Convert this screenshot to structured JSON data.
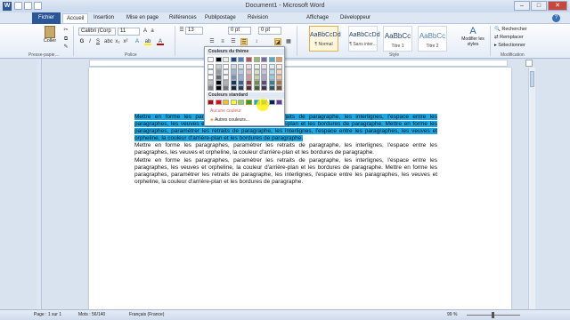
{
  "window": {
    "title": "Document1 - Microsoft Word"
  },
  "tabs": [
    "Fichier",
    "Accueil",
    "Insertion",
    "Mise en page",
    "Références",
    "Publipostage",
    "Révision",
    "Affichage",
    "Développeur"
  ],
  "ribbon": {
    "groups": {
      "clipboard": "Presse-papie…",
      "font": "Police",
      "paragraph": "",
      "styles": "Style",
      "edit": "Modification"
    },
    "paste_label": "Coller",
    "font_name": "Calibri (Corp",
    "font_size": "11",
    "spacing_value": "13",
    "before_value": "0 pt",
    "after_value": "0 pt",
    "styles": [
      {
        "sample": "AaBbCcDd",
        "label": "¶ Normal"
      },
      {
        "sample": "AaBbCcDd",
        "label": "¶ Sans inter..."
      },
      {
        "sample": "AaBbCc",
        "label": "Titre 1"
      },
      {
        "sample": "AaBbCc",
        "label": "Titre 2"
      }
    ],
    "change_styles": "Modifier les styles",
    "search": "Rechercher",
    "replace": "Remplacer",
    "select": "Sélectionner"
  },
  "palette": {
    "theme_header": "Couleurs du thème",
    "standard_header": "Couleurs standard",
    "none_label": "Aucune couleur",
    "more_label": "Autres couleurs...",
    "theme_top": [
      "#ffffff",
      "#000000",
      "#eeece1",
      "#1f497d",
      "#4f81bd",
      "#c0504d",
      "#9bbb59",
      "#8064a2",
      "#4bacc6",
      "#f79646"
    ],
    "standard": [
      "#c00000",
      "#ff0000",
      "#ffc000",
      "#ffff00",
      "#92d050",
      "#00b050",
      "#00b0f0",
      "#0070c0",
      "#002060",
      "#7030a0"
    ]
  },
  "document": {
    "p1_hl": "Mettre en forme les paragraphes, paramétrer les retraits de paragraphe, les interlignes, l'espace entre les paragraphes, les veuves et orpheline, la couleur d'arrière-plan et les bordures de paragraphe. Mettre en forme les paragraphes, paramétrer les retraits de paragraphe, les interlignes, l'espace entre les paragraphes, les veuves et orpheline, la couleur d'arrière-plan et les bordures de paragraphe.",
    "p2": "Mettre en forme les paragraphes, paramétrer les retraits de paragraphe, les interlignes, l'espace entre les paragraphes, les veuves et orpheline, la couleur d'arrière-plan et les bordures de paragraphe.",
    "p3": "Mettre en forme les paragraphes, paramétrer les retraits de paragraphe, les interlignes, l'espace entre les paragraphes, les veuves et orpheline, la couleur d'arrière-plan et les bordures de paragraphe. Mettre en forme les paragraphes, paramétrer les retraits de paragraphe, les interlignes, l'espace entre les paragraphes, les veuves et orpheline, la couleur d'arrière-plan et les bordures de paragraphe."
  },
  "status": {
    "page": "Page : 1 sur 1",
    "words": "Mots : 56/140",
    "lang": "Français (France)",
    "zoom": "99 %"
  }
}
